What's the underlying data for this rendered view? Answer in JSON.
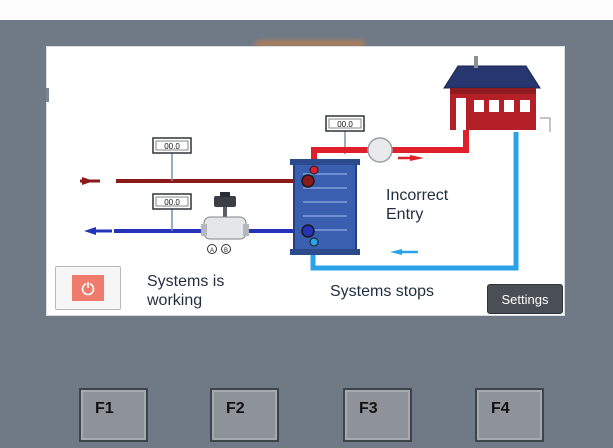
{
  "screen": {
    "sensor_readouts": [
      "00.0",
      "00.0",
      "00.0"
    ],
    "status_left": "Systems is\nworking",
    "status_right": "Systems stops",
    "error_message": "Incorrect\nEntry",
    "settings_label": "Settings",
    "power_icon": "power-icon"
  },
  "function_keys": [
    "F1",
    "F2",
    "F3",
    "F4"
  ],
  "colors": {
    "hot_line": "#8b1a1a",
    "hot_line_bright": "#e01f2d",
    "cold_line": "#2433b8",
    "return_line": "#2aa3e8",
    "heat_exchanger": "#3a5fb0",
    "power_button": "#f07b6d",
    "settings_button": "#4a4f55",
    "panel_bg": "#6f7a86"
  }
}
